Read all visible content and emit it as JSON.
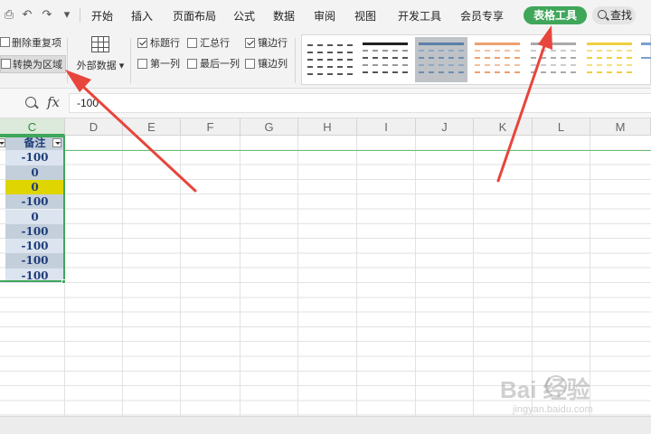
{
  "menubar": {
    "tabs": [
      "开始",
      "插入",
      "页面布局",
      "公式",
      "数据",
      "审阅",
      "视图",
      "开发工具",
      "会员专享"
    ],
    "active_tab": "表格工具",
    "search_label": "查找"
  },
  "ribbon": {
    "remove_duplicates": "删除重复项",
    "convert_to_range": "转换为区域",
    "external_data": "外部数据",
    "checkboxes": [
      {
        "label": "标题行",
        "checked": true
      },
      {
        "label": "汇总行",
        "checked": false
      },
      {
        "label": "镶边行",
        "checked": true
      },
      {
        "label": "第一列",
        "checked": false
      },
      {
        "label": "最后一列",
        "checked": false
      },
      {
        "label": "镶边列",
        "checked": false
      }
    ]
  },
  "formula_bar": {
    "fx": "fx",
    "value": "-100"
  },
  "sheet": {
    "columns": [
      "C",
      "D",
      "E",
      "F",
      "G",
      "H",
      "I",
      "J",
      "K",
      "L",
      "M"
    ],
    "active_column": "C",
    "table_header": "备注",
    "table_values": [
      "-100",
      "0",
      "0",
      "-100",
      "0",
      "-100",
      "-100",
      "-100",
      "-100"
    ]
  },
  "watermark": {
    "logo": "Bai 经验",
    "url": "jingyan.baidu.com"
  },
  "colors": {
    "accent_green": "#3fa65a",
    "annotation_red": "#e8453c",
    "band_dark": "#c4cfdc",
    "band_light": "#dbe4ef",
    "highlight_yellow": "#dfd500",
    "value_text": "#1f3d7a"
  }
}
